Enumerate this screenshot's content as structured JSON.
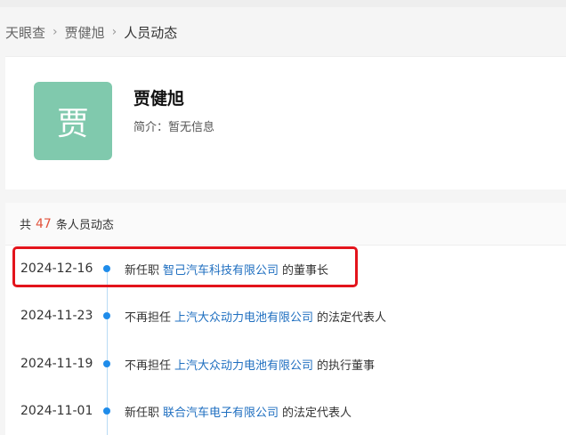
{
  "breadcrumb": {
    "items": [
      "天眼查",
      "贾健旭",
      "人员动态"
    ],
    "separator": "›"
  },
  "profile": {
    "avatar_char": "贾",
    "name": "贾健旭",
    "intro_label": "简介：",
    "intro_value": "暂无信息"
  },
  "feed": {
    "prefix": "共",
    "count": "47",
    "suffix": "条人员动态",
    "rows": [
      {
        "date": "2024-12-16",
        "action": "新任职",
        "company": "智己汽车科技有限公司",
        "role": "的董事长"
      },
      {
        "date": "2024-11-23",
        "action": "不再担任",
        "company": "上汽大众动力电池有限公司",
        "role": "的法定代表人"
      },
      {
        "date": "2024-11-19",
        "action": "不再担任",
        "company": "上汽大众动力电池有限公司",
        "role": "的执行董事"
      },
      {
        "date": "2024-11-01",
        "action": "新任职",
        "company": "联合汽车电子有限公司",
        "role": "的法定代表人"
      }
    ]
  },
  "colors": {
    "avatar_bg": "#80c9ad",
    "link": "#1f6fc0",
    "count": "#e2533c",
    "timeline_dot": "#1f8cea",
    "highlight": "#e3141c"
  }
}
